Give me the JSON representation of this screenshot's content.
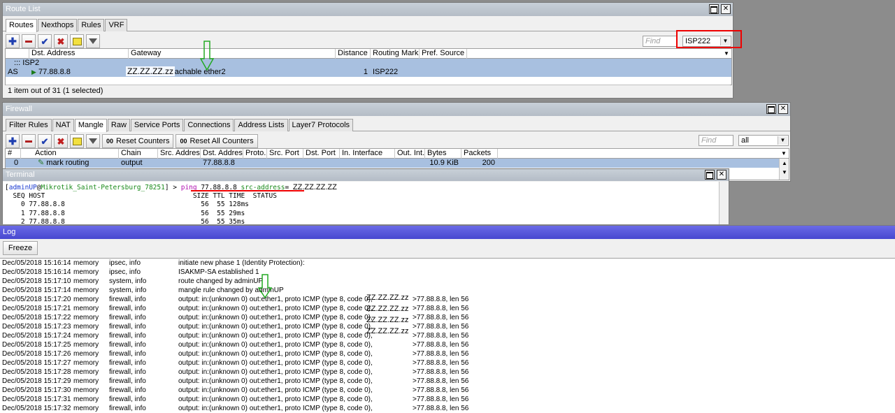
{
  "route_list": {
    "title": "Route List",
    "tabs": [
      "Routes",
      "Nexthops",
      "Rules",
      "VRF"
    ],
    "find_placeholder": "Find",
    "filter_value": "ISP222",
    "columns": [
      "Dst. Address",
      "Gateway",
      "Distance",
      "Routing Mark",
      "Pref. Source"
    ],
    "group_label": "::: ISP2",
    "row": {
      "flags": "AS",
      "dst": "77.88.8.8",
      "gateway": "reachable ether2",
      "distance": "1",
      "routing_mark": "ISP222",
      "pref_source": ""
    },
    "gateway_annotation": "ZZ.ZZ.ZZ.zz",
    "status": "1 item out of 31 (1 selected)"
  },
  "firewall": {
    "title": "Firewall",
    "tabs": [
      "Filter Rules",
      "NAT",
      "Mangle",
      "Raw",
      "Service Ports",
      "Connections",
      "Address Lists",
      "Layer7 Protocols"
    ],
    "buttons": {
      "reset_counters": "Reset Counters",
      "reset_all": "Reset All Counters",
      "counter_glyph": "00"
    },
    "find_placeholder": "Find",
    "filter_value": "all",
    "columns": [
      "#",
      "Action",
      "Chain",
      "Src. Address",
      "Dst. Address",
      "Proto...",
      "Src. Port",
      "Dst. Port",
      "In. Interface",
      "Out. Int...",
      "Bytes",
      "Packets"
    ],
    "row": {
      "num": "0",
      "action": "mark routing",
      "chain": "output",
      "src": "",
      "dst": "77.88.8.8",
      "bytes": "10.9 KiB",
      "packets": "200"
    }
  },
  "terminal": {
    "title": "Terminal",
    "prompt_user": "adminUP",
    "prompt_at": "@",
    "prompt_host": "Mikrotik_Saint-Petersburg_78251",
    "prompt_end": "] > ",
    "cmd_ping": "ping",
    "cmd_ip": " 77.88.8.8 ",
    "cmd_src": "src-address",
    "cmd_eq": "=",
    "src_annotation": "ZZ.ZZ.ZZ.ZZ",
    "header": "  SEQ HOST                                     SIZE TTL TIME  STATUS",
    "lines": [
      "    0 77.88.8.8                                  56  55 128ms",
      "    1 77.88.8.8                                  56  55 29ms",
      "    2 77.88.8.8                                  56  55 35ms"
    ]
  },
  "log": {
    "title": "Log",
    "freeze_label": "Freeze",
    "rows": [
      {
        "time": "Dec/05/2018 15:16:14",
        "buffer": "memory",
        "topics": "ipsec, info",
        "message": "initiate new phase 1 (Identity Protection):",
        "tail": ""
      },
      {
        "time": "Dec/05/2018 15:16:14",
        "buffer": "memory",
        "topics": "ipsec, info",
        "message": "ISAKMP-SA established 1",
        "tail": ""
      },
      {
        "time": "Dec/05/2018 15:17:10",
        "buffer": "memory",
        "topics": "system, info",
        "message": "route changed by adminUP",
        "tail": ""
      },
      {
        "time": "Dec/05/2018 15:17:14",
        "buffer": "memory",
        "topics": "system, info",
        "message": "mangle rule changed by adminUP",
        "tail": ""
      },
      {
        "time": "Dec/05/2018 15:17:20",
        "buffer": "memory",
        "topics": "firewall, info",
        "message": "output: in:(unknown 0) out:ether1, proto ICMP (type 8, code 0),",
        "tail": ">77.88.8.8, len 56"
      },
      {
        "time": "Dec/05/2018 15:17:21",
        "buffer": "memory",
        "topics": "firewall, info",
        "message": "output: in:(unknown 0) out:ether1, proto ICMP (type 8, code 0),",
        "tail": ">77.88.8.8, len 56"
      },
      {
        "time": "Dec/05/2018 15:17:22",
        "buffer": "memory",
        "topics": "firewall, info",
        "message": "output: in:(unknown 0) out:ether1, proto ICMP (type 8, code 0),",
        "tail": ">77.88.8.8, len 56"
      },
      {
        "time": "Dec/05/2018 15:17:23",
        "buffer": "memory",
        "topics": "firewall, info",
        "message": "output: in:(unknown 0) out:ether1, proto ICMP (type 8, code 0),",
        "tail": ">77.88.8.8, len 56"
      },
      {
        "time": "Dec/05/2018 15:17:24",
        "buffer": "memory",
        "topics": "firewall, info",
        "message": "output: in:(unknown 0) out:ether1, proto ICMP (type 8, code 0),",
        "tail": ">77.88.8.8, len 56"
      },
      {
        "time": "Dec/05/2018 15:17:25",
        "buffer": "memory",
        "topics": "firewall, info",
        "message": "output: in:(unknown 0) out:ether1, proto ICMP (type 8, code 0),",
        "tail": ">77.88.8.8, len 56"
      },
      {
        "time": "Dec/05/2018 15:17:26",
        "buffer": "memory",
        "topics": "firewall, info",
        "message": "output: in:(unknown 0) out:ether1, proto ICMP (type 8, code 0),",
        "tail": ">77.88.8.8, len 56"
      },
      {
        "time": "Dec/05/2018 15:17:27",
        "buffer": "memory",
        "topics": "firewall, info",
        "message": "output: in:(unknown 0) out:ether1, proto ICMP (type 8, code 0),",
        "tail": ">77.88.8.8, len 56"
      },
      {
        "time": "Dec/05/2018 15:17:28",
        "buffer": "memory",
        "topics": "firewall, info",
        "message": "output: in:(unknown 0) out:ether1, proto ICMP (type 8, code 0),",
        "tail": ">77.88.8.8, len 56"
      },
      {
        "time": "Dec/05/2018 15:17:29",
        "buffer": "memory",
        "topics": "firewall, info",
        "message": "output: in:(unknown 0) out:ether1, proto ICMP (type 8, code 0),",
        "tail": ">77.88.8.8, len 56"
      },
      {
        "time": "Dec/05/2018 15:17:30",
        "buffer": "memory",
        "topics": "firewall, info",
        "message": "output: in:(unknown 0) out:ether1, proto ICMP (type 8, code 0),",
        "tail": ">77.88.8.8, len 56"
      },
      {
        "time": "Dec/05/2018 15:17:31",
        "buffer": "memory",
        "topics": "firewall, info",
        "message": "output: in:(unknown 0) out:ether1, proto ICMP (type 8, code 0),",
        "tail": ">77.88.8.8, len 56"
      },
      {
        "time": "Dec/05/2018 15:17:32",
        "buffer": "memory",
        "topics": "firewall, info",
        "message": "output: in:(unknown 0) out:ether1, proto ICMP (type 8, code 0),",
        "tail": ">77.88.8.8, len 56"
      }
    ],
    "src_annotations": [
      "ZZ.ZZ.ZZ.zz",
      "ZZ.ZZ.ZZ.zz",
      "ZZ.ZZ.ZZ.zz",
      "ZZ.ZZ.ZZ.zz"
    ]
  },
  "colors": {
    "selected_row": "#a8c0e0",
    "log_titlebar": "#5a5ad8",
    "annotation_red": "#e00000",
    "annotation_green": "#22aa22"
  }
}
